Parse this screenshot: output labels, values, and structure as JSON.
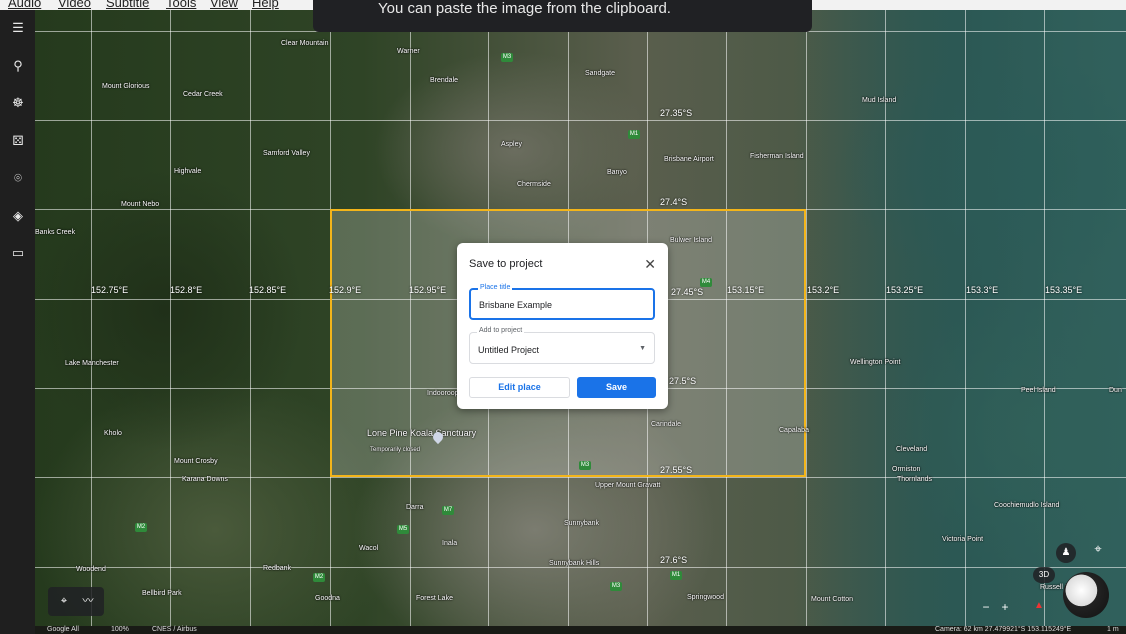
{
  "menubar": {
    "items": [
      "Audio",
      "Video",
      "Subtitle",
      "Tools",
      "View",
      "Help"
    ]
  },
  "toast": {
    "text": "You can paste the image from the clipboard."
  },
  "sidebar": {
    "icons": [
      "menu-icon",
      "search-icon",
      "voyager-icon",
      "dice-icon",
      "place-icon",
      "layers-icon",
      "ruler-icon"
    ]
  },
  "map": {
    "longitudes": [
      "152.75°E",
      "152.8°E",
      "152.85°E",
      "152.9°E",
      "152.95°E",
      "153.15°E",
      "153.2°E",
      "153.25°E",
      "153.3°E",
      "153.35°E"
    ],
    "latitudes": [
      "27.35°S",
      "27.4°S",
      "27.45°S",
      "27.5°S",
      "27.55°S",
      "27.6°S"
    ],
    "places": [
      "Clear Mountain",
      "Warner",
      "Brendale",
      "Sandgate",
      "Mount Glorious",
      "Cedar Creek",
      "Mud Island",
      "Aspley",
      "Brisbane Airport",
      "Fisherman Island",
      "Samford Valley",
      "Highvale",
      "Banyo",
      "Chermside",
      "Mount Nebo",
      "Bulwer Island",
      "Lake Manchester",
      "Wellington Point",
      "Peel Island",
      "Lone Pine Koala Sanctuary",
      "Temporarily closed",
      "Indooroopilly",
      "Carindale",
      "Capalaba",
      "Kholo",
      "Mount Crosby",
      "Karana Downs",
      "Cleveland",
      "Ormiston",
      "Thornlands",
      "Upper Mount Gravatt",
      "Darra",
      "Sunnybank",
      "Wacol",
      "Inala",
      "Coochiemudlo Island",
      "Victoria Point",
      "Woodend",
      "Redbank",
      "Goodna",
      "Forest Lake",
      "Sunnybank Hills",
      "Springwood",
      "Mount Cotton",
      "Bellbird Park",
      "Russell Island",
      "Dun",
      "Banks Creek"
    ],
    "roads": [
      "M3",
      "M1",
      "M4",
      "M2",
      "M5",
      "M7"
    ]
  },
  "dialog": {
    "title": "Save to project",
    "place_title_label": "Place title",
    "place_title_value": "Brisbane Example",
    "project_label": "Add to project",
    "project_value": "Untitled Project",
    "edit_button": "Edit place",
    "save_button": "Save"
  },
  "controls": {
    "mode_3d": "3D",
    "zoom_out": "−",
    "zoom_in": "+"
  },
  "status": {
    "attribution_google": "Google All",
    "zoom": "100%",
    "data_provider": "CNES / Airbus",
    "camera": "Camera: 62 km  27.479921°S 153.115249°E",
    "scale": "1 m"
  },
  "colors": {
    "accent": "#1a73e8",
    "highlight": "#f3b51a",
    "toolbar": "#1f1f1f"
  }
}
